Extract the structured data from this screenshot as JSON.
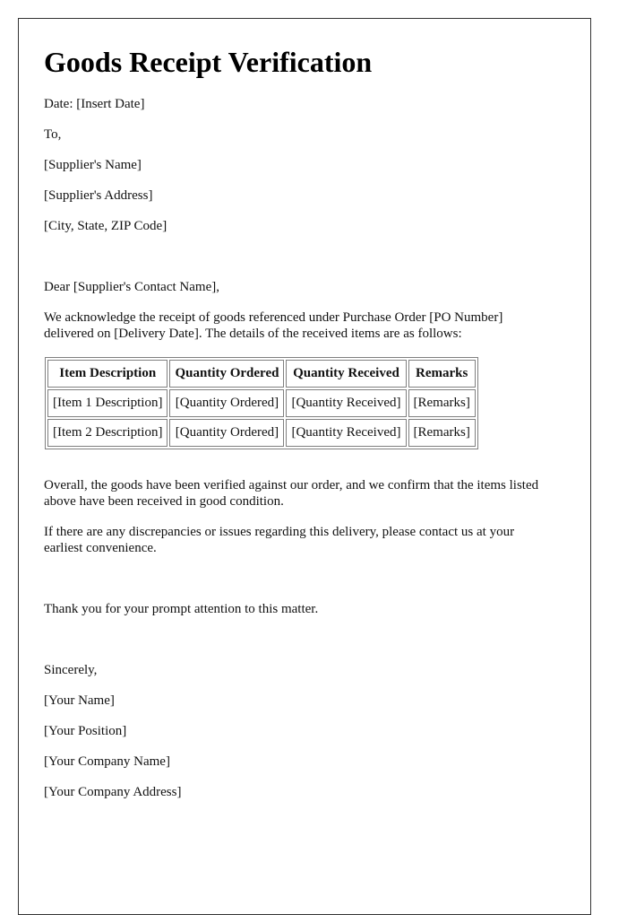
{
  "document": {
    "title": "Goods Receipt Verification",
    "date_line": "Date: [Insert Date]",
    "recipient": {
      "salutation_to": "To,",
      "name": "[Supplier's Name]",
      "address": "[Supplier's Address]",
      "city_state_zip": "[City, State, ZIP Code]"
    },
    "greeting": "Dear [Supplier's Contact Name],",
    "intro_paragraph": "We acknowledge the receipt of goods referenced under Purchase Order [PO Number] delivered on [Delivery Date]. The details of the received items are as follows:",
    "table": {
      "headers": [
        "Item Description",
        "Quantity Ordered",
        "Quantity Received",
        "Remarks"
      ],
      "rows": [
        [
          "[Item 1 Description]",
          "[Quantity Ordered]",
          "[Quantity Received]",
          "[Remarks]"
        ],
        [
          "[Item 2 Description]",
          "[Quantity Ordered]",
          "[Quantity Received]",
          "[Remarks]"
        ]
      ]
    },
    "verification_paragraph": "Overall, the goods have been verified against our order, and we confirm that the items listed above have been received in good condition.",
    "discrepancy_paragraph": "If there are any discrepancies or issues regarding this delivery, please contact us at your earliest convenience.",
    "thanks_paragraph": "Thank you for your prompt attention to this matter.",
    "closing": "Sincerely,",
    "sender": {
      "name": "[Your Name]",
      "position": "[Your Position]",
      "company_name": "[Your Company Name]",
      "company_address": "[Your Company Address]"
    }
  }
}
